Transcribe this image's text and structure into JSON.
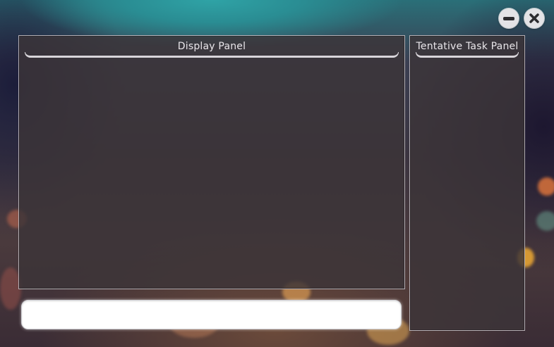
{
  "window": {
    "controls": [
      {
        "name": "minimize",
        "icon": "minimize-icon"
      },
      {
        "name": "close",
        "icon": "close-icon"
      }
    ]
  },
  "display_panel": {
    "title": "Display Panel",
    "content": ""
  },
  "task_panel": {
    "title": "Tentative Task Panel",
    "items": []
  },
  "command": {
    "value": "",
    "placeholder": ""
  },
  "colors": {
    "panel_bg": "#3c3438",
    "panel_border": "#dcd7dc",
    "header_text": "#e9e6ea",
    "button_bg": "#e3e3e6",
    "input_bg": "#ffffff"
  }
}
